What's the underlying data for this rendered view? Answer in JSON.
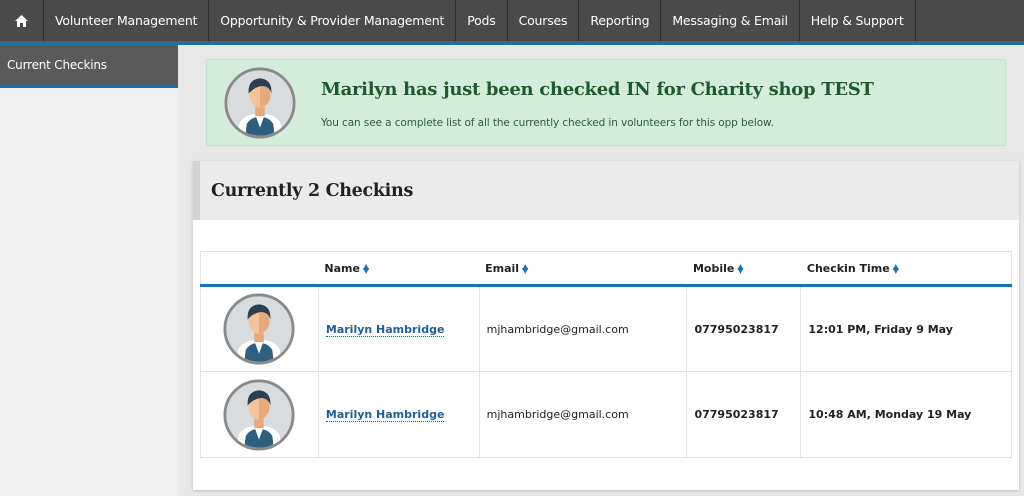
{
  "nav": {
    "home_icon": "home-icon",
    "items": [
      "Volunteer Management",
      "Opportunity & Provider Management",
      "Pods",
      "Courses",
      "Reporting",
      "Messaging & Email",
      "Help & Support"
    ]
  },
  "sidebar": {
    "items": [
      "Current Checkins"
    ]
  },
  "alert": {
    "title": "Marilyn has just been checked IN for Charity shop TEST",
    "message": "You can see a complete list of all the currently checked in volunteers for this opp below."
  },
  "panel": {
    "title": "Currently 2 Checkins",
    "columns": [
      "Name",
      "Email",
      "Mobile",
      "Checkin Time"
    ],
    "rows": [
      {
        "name": "Marilyn Hambridge",
        "email": "mjhambridge@gmail.com",
        "mobile": "07795023817",
        "time": "12:01 PM, Friday 9 May"
      },
      {
        "name": "Marilyn Hambridge",
        "email": "mjhambridge@gmail.com",
        "mobile": "07795023817",
        "time": "10:48 AM, Monday 19 May"
      }
    ]
  },
  "colors": {
    "accent": "#1f6fab",
    "nav_bg": "#4a4a4a",
    "alert_bg": "#d4edda",
    "alert_text": "#1f5a2c"
  }
}
